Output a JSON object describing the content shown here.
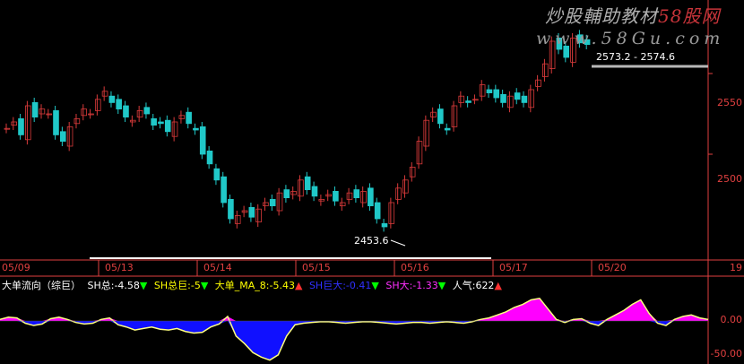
{
  "watermark": {
    "title_main": "炒股輔助教材",
    "title_brand": "58股网",
    "url": "www.58Gu.com"
  },
  "colors": {
    "bg": "#000000",
    "up": "#d83a3a",
    "down": "#20c8c8",
    "axis": "#e14040",
    "pos_fill": "#ff00ff",
    "neg_fill": "#1010ff",
    "line": "#ffff80"
  },
  "annotations": {
    "high_range": "2573.2 - 2574.6",
    "low": "2453.6"
  },
  "chart_data": [
    {
      "type": "candlestick",
      "x": [
        "05/09",
        "05/13",
        "05/14",
        "05/15",
        "05/16",
        "05/17",
        "05/20"
      ],
      "yticks": [
        "2550",
        "2500"
      ],
      "ylim": [
        2440,
        2590
      ],
      "close": [
        2516,
        2520,
        2512,
        2530,
        2523,
        2528,
        2525,
        2512,
        2508,
        2517,
        2522,
        2528,
        2525,
        2534,
        2539,
        2532,
        2528,
        2523,
        2521,
        2527,
        2525,
        2518,
        2519,
        2514,
        2520,
        2524,
        2519,
        2515,
        2500,
        2494,
        2484,
        2470,
        2460,
        2462,
        2465,
        2461,
        2466,
        2470,
        2468,
        2476,
        2473,
        2477,
        2484,
        2478,
        2474,
        2472,
        2475,
        2471,
        2470,
        2476,
        2473,
        2477,
        2468,
        2460,
        2455,
        2470,
        2479,
        2484,
        2492,
        2508,
        2521,
        2526,
        2519,
        2515,
        2530,
        2536,
        2532,
        2534,
        2543,
        2538,
        2535,
        2532,
        2536,
        2534,
        2532,
        2540,
        2546,
        2556,
        2570,
        2565,
        2560,
        2572,
        2569,
        2568
      ],
      "ticks_right": {
        "bottom": "19"
      }
    },
    {
      "type": "area",
      "title": "大单流向（综巨）",
      "legend": [
        {
          "label": "SH总:-4.58",
          "color": "#ffffff",
          "arrow": "▼",
          "arrow_color": "#00ff00"
        },
        {
          "label": "SH总巨:-5",
          "color": "#ffff00",
          "arrow": "▼",
          "arrow_color": "#00ff00"
        },
        {
          "label": "大单_MA_8:-5.43",
          "color": "#ffff00",
          "arrow": "▲",
          "arrow_color": "#ff3030"
        },
        {
          "label": "SH巨大:-0.41",
          "color": "#3030ff",
          "arrow": "▼",
          "arrow_color": "#00ff00"
        },
        {
          "label": "SH大:-1.33",
          "color": "#ff30ff",
          "arrow": "▼",
          "arrow_color": "#00ff00"
        },
        {
          "label": "人气:622",
          "color": "#ffffff",
          "arrow": "▲",
          "arrow_color": "#ff3030"
        }
      ],
      "yticks": [
        "0.00",
        "-50.00"
      ],
      "ylim": [
        -55,
        35
      ],
      "values": [
        2,
        5,
        4,
        -3,
        -6,
        -4,
        3,
        5,
        2,
        -2,
        -4,
        -3,
        2,
        4,
        -5,
        -8,
        -12,
        -10,
        -8,
        -11,
        -12,
        -10,
        -14,
        -16,
        -15,
        -8,
        -4,
        6,
        -20,
        -30,
        -42,
        -48,
        -52,
        -45,
        -20,
        -5,
        -3,
        -2,
        -1,
        -1,
        -2,
        -3,
        -2,
        -1,
        -1,
        -2,
        -3,
        -4,
        -3,
        -2,
        -2,
        -3,
        -2,
        -1,
        -2,
        -3,
        -1,
        2,
        4,
        8,
        12,
        18,
        22,
        28,
        30,
        16,
        2,
        -2,
        2,
        3,
        -3,
        -6,
        2,
        8,
        14,
        22,
        28,
        10,
        -3,
        -6,
        2,
        6,
        8,
        4,
        2
      ]
    }
  ]
}
